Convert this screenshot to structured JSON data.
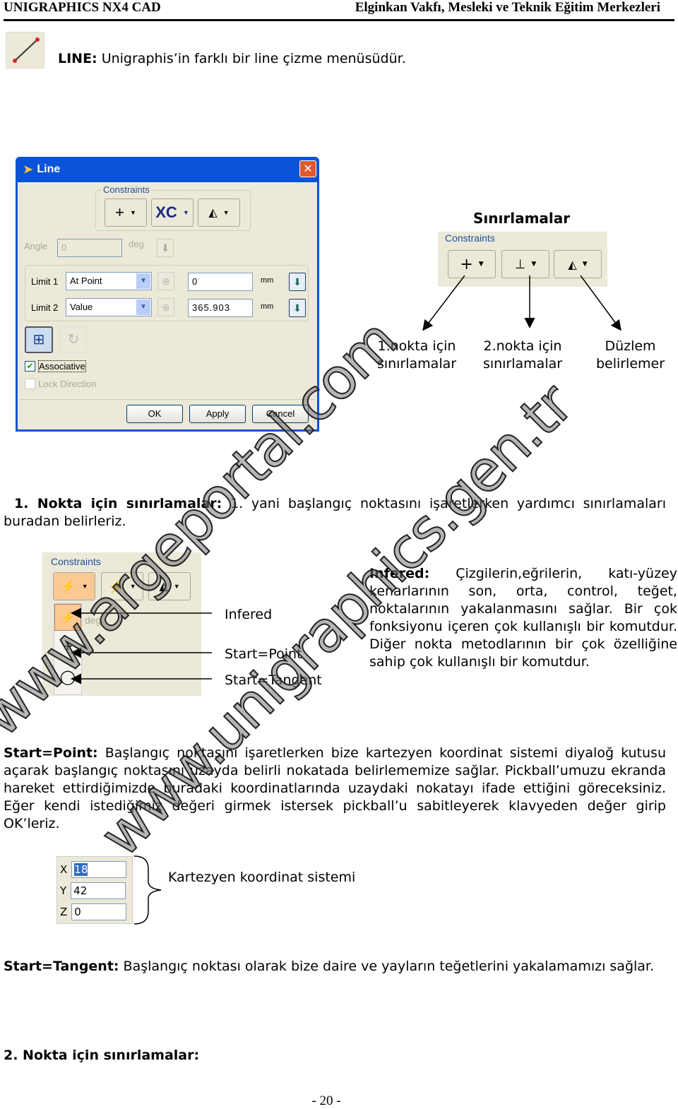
{
  "header": {
    "left": "UNIGRAPHICS NX4 CAD",
    "right": "Elginkan Vakfı, Mesleki ve Teknik Eğitim Merkezleri"
  },
  "intro": {
    "icon": "line-icon",
    "label": "LINE:",
    "text": " Unigraphis’in farklı bir line çizme menüsüdür."
  },
  "dialog": {
    "title": "Line",
    "close": "✕",
    "constraints_label": "Constraints",
    "toolbar": [
      {
        "icon": "point-plus-icon",
        "glyph": "+"
      },
      {
        "icon": "xc-icon",
        "glyph": "XC"
      },
      {
        "icon": "ruler-icon",
        "glyph": "📐"
      }
    ],
    "angle_label": "Angle",
    "angle_value": "0",
    "angle_unit": "deg",
    "limit1": {
      "label": "Limit 1",
      "option": "At Point",
      "value": "0",
      "unit": "mm"
    },
    "limit2": {
      "label": "Limit 2",
      "option": "Value",
      "value": "365.903",
      "unit": "mm"
    },
    "associative": "Associative",
    "associative_checked": true,
    "lock_direction": "Lock Direction",
    "lock_checked": false,
    "ok": "OK",
    "apply": "Apply",
    "cancel": "Cancel"
  },
  "sinirlamalar": {
    "title": "Sınırlamalar",
    "constraints_label": "Constraints",
    "labels": [
      "1.nokta için sınırlamalar",
      "2.nokta için sınırlamalar",
      "Düzlem belirlemer"
    ],
    "labels_lines": [
      [
        "1.nokta için",
        "sınırlamalar"
      ],
      [
        "2.nokta için",
        "sınırlamalar"
      ],
      [
        "Düzlem",
        "belirlemer"
      ]
    ]
  },
  "para1": {
    "bold": "1. Nokta için sınırlamalar:",
    "text": " 1. yani başlangıç noktasını işaretlerken yardımcı sınırlamaları buradan belirleriz."
  },
  "snippet": {
    "constraints_label": "Constraints",
    "deg": "deg",
    "items": [
      "Infered",
      "Start=Point",
      "Start=Tangent"
    ]
  },
  "infered": {
    "bold": "Infered:",
    "text": " Çizgilerin,eğrilerin, katı-yüzey kenarlarının son, orta, control, teğet, noktalarının yakalanmasını sağlar. Bir çok fonksiyonu içeren çok kullanışlı bir komutdur. Diğer  nokta metodlarının bir çok özelliğine sahip çok kullanışlı bir komutdur."
  },
  "para2": {
    "bold": "Start=Point:",
    "text": " Başlangıç noktasını işaretlerken bize kartezyen koordinat sistemi diyaloğ kutusu açarak başlangıç noktasını uzayda belirli nokatada belirlememize sağlar. Pickball’umuzu ekranda hareket ettirdiğimizde buradaki koordinatlarında uzaydaki nokatayı ifade ettiğini göreceksiniz. Eğer kendi istediğimiz değeri girmek istersek pickball’u sabitleyerek klavyeden değer girip OK’leriz."
  },
  "coords": {
    "x_label": "X",
    "x": "18",
    "y_label": "Y",
    "y": "42",
    "z_label": "Z",
    "z": "0",
    "caption": "Kartezyen koordinat sistemi"
  },
  "para3": {
    "bold": "Start=Tangent:",
    "text": " Başlangıç noktası olarak bize daire ve yayların teğetlerini yakalamamızı sağlar."
  },
  "heading2": "2. Nokta için sınırlamalar:",
  "footer": "- 20 -",
  "watermarks": [
    "www.argeportal.com",
    "www.unigraphics.gen.tr"
  ]
}
